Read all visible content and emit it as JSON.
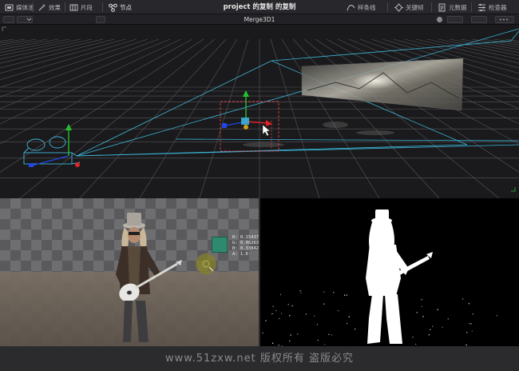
{
  "toolbar": {
    "left_items": [
      {
        "label": "媒体池",
        "icon": "media-pool-icon"
      },
      {
        "label": "效果",
        "icon": "effects-icon"
      },
      {
        "label": "片段",
        "icon": "clips-icon"
      },
      {
        "label": "节点",
        "icon": "nodes-icon"
      }
    ],
    "project_title": "project 的复制 的复制",
    "right_items": [
      {
        "label": "样条线",
        "icon": "spline-icon"
      },
      {
        "label": "关键帧",
        "icon": "keyframes-icon"
      },
      {
        "label": "元数据",
        "icon": "metadata-icon"
      },
      {
        "label": "检查器",
        "icon": "inspector-icon"
      }
    ]
  },
  "viewer": {
    "title": "Merge3D1"
  },
  "color_picker": {
    "swatch_color": "#2d8a6e",
    "r": "R: 0.15437",
    "g": "G: 0.46263",
    "b": "B: 0.33842",
    "a": "A: 1.0"
  },
  "footer": {
    "watermark": "www.51zxw.net 版权所有 盗版必究"
  },
  "colors": {
    "grid": "#5a5a5e",
    "camera_wire": "#3cb4d8",
    "axis_x": "#e0222a",
    "axis_y": "#23c42b",
    "axis_z": "#2046e6",
    "selection": "#e0404a"
  }
}
